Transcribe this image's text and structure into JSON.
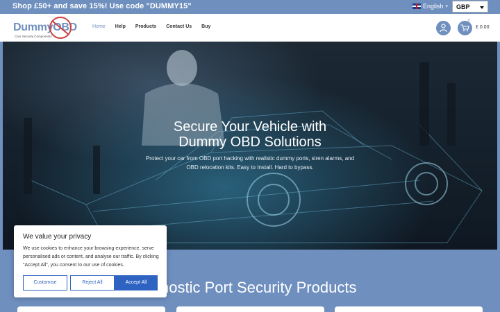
{
  "promo": {
    "text": "Shop £50+ and save 15%! Use code \"DUMMY15\""
  },
  "language": {
    "label": "English"
  },
  "currency": {
    "selected": "GBP"
  },
  "logo": {
    "word": "Dummy",
    "accent": "OBD",
    "tagline": "Cars Security Components"
  },
  "nav": {
    "items": [
      "Home",
      "Help",
      "Products",
      "Contact Us",
      "Buy"
    ]
  },
  "cart": {
    "count": "0",
    "total": "£ 0.00"
  },
  "hero": {
    "title_line1": "Secure Your Vehicle with",
    "title_line2": "Dummy OBD Solutions",
    "subtitle": "Protect your car from OBD port hacking with realistic dummy ports, siren alarms, and OBD relocation kits. Easy to Install. Hard to bypass."
  },
  "section": {
    "title": "agnostic Port Security Products"
  },
  "cookie": {
    "title": "We value your privacy",
    "body": "We use cookies to enhance your browsing experience, serve personalised ads or content, and analyse our traffic. By clicking \"Accept All\", you consent to our use of cookies.",
    "customise": "Customise",
    "reject": "Reject All",
    "accept": "Accept All"
  },
  "colors": {
    "brand": "#6f8fbf",
    "accept_button": "#2f63c2",
    "logo_ring": "#c44444"
  },
  "icons": {
    "user": "user-icon",
    "cart": "cart-icon",
    "flag": "uk-flag-icon"
  }
}
